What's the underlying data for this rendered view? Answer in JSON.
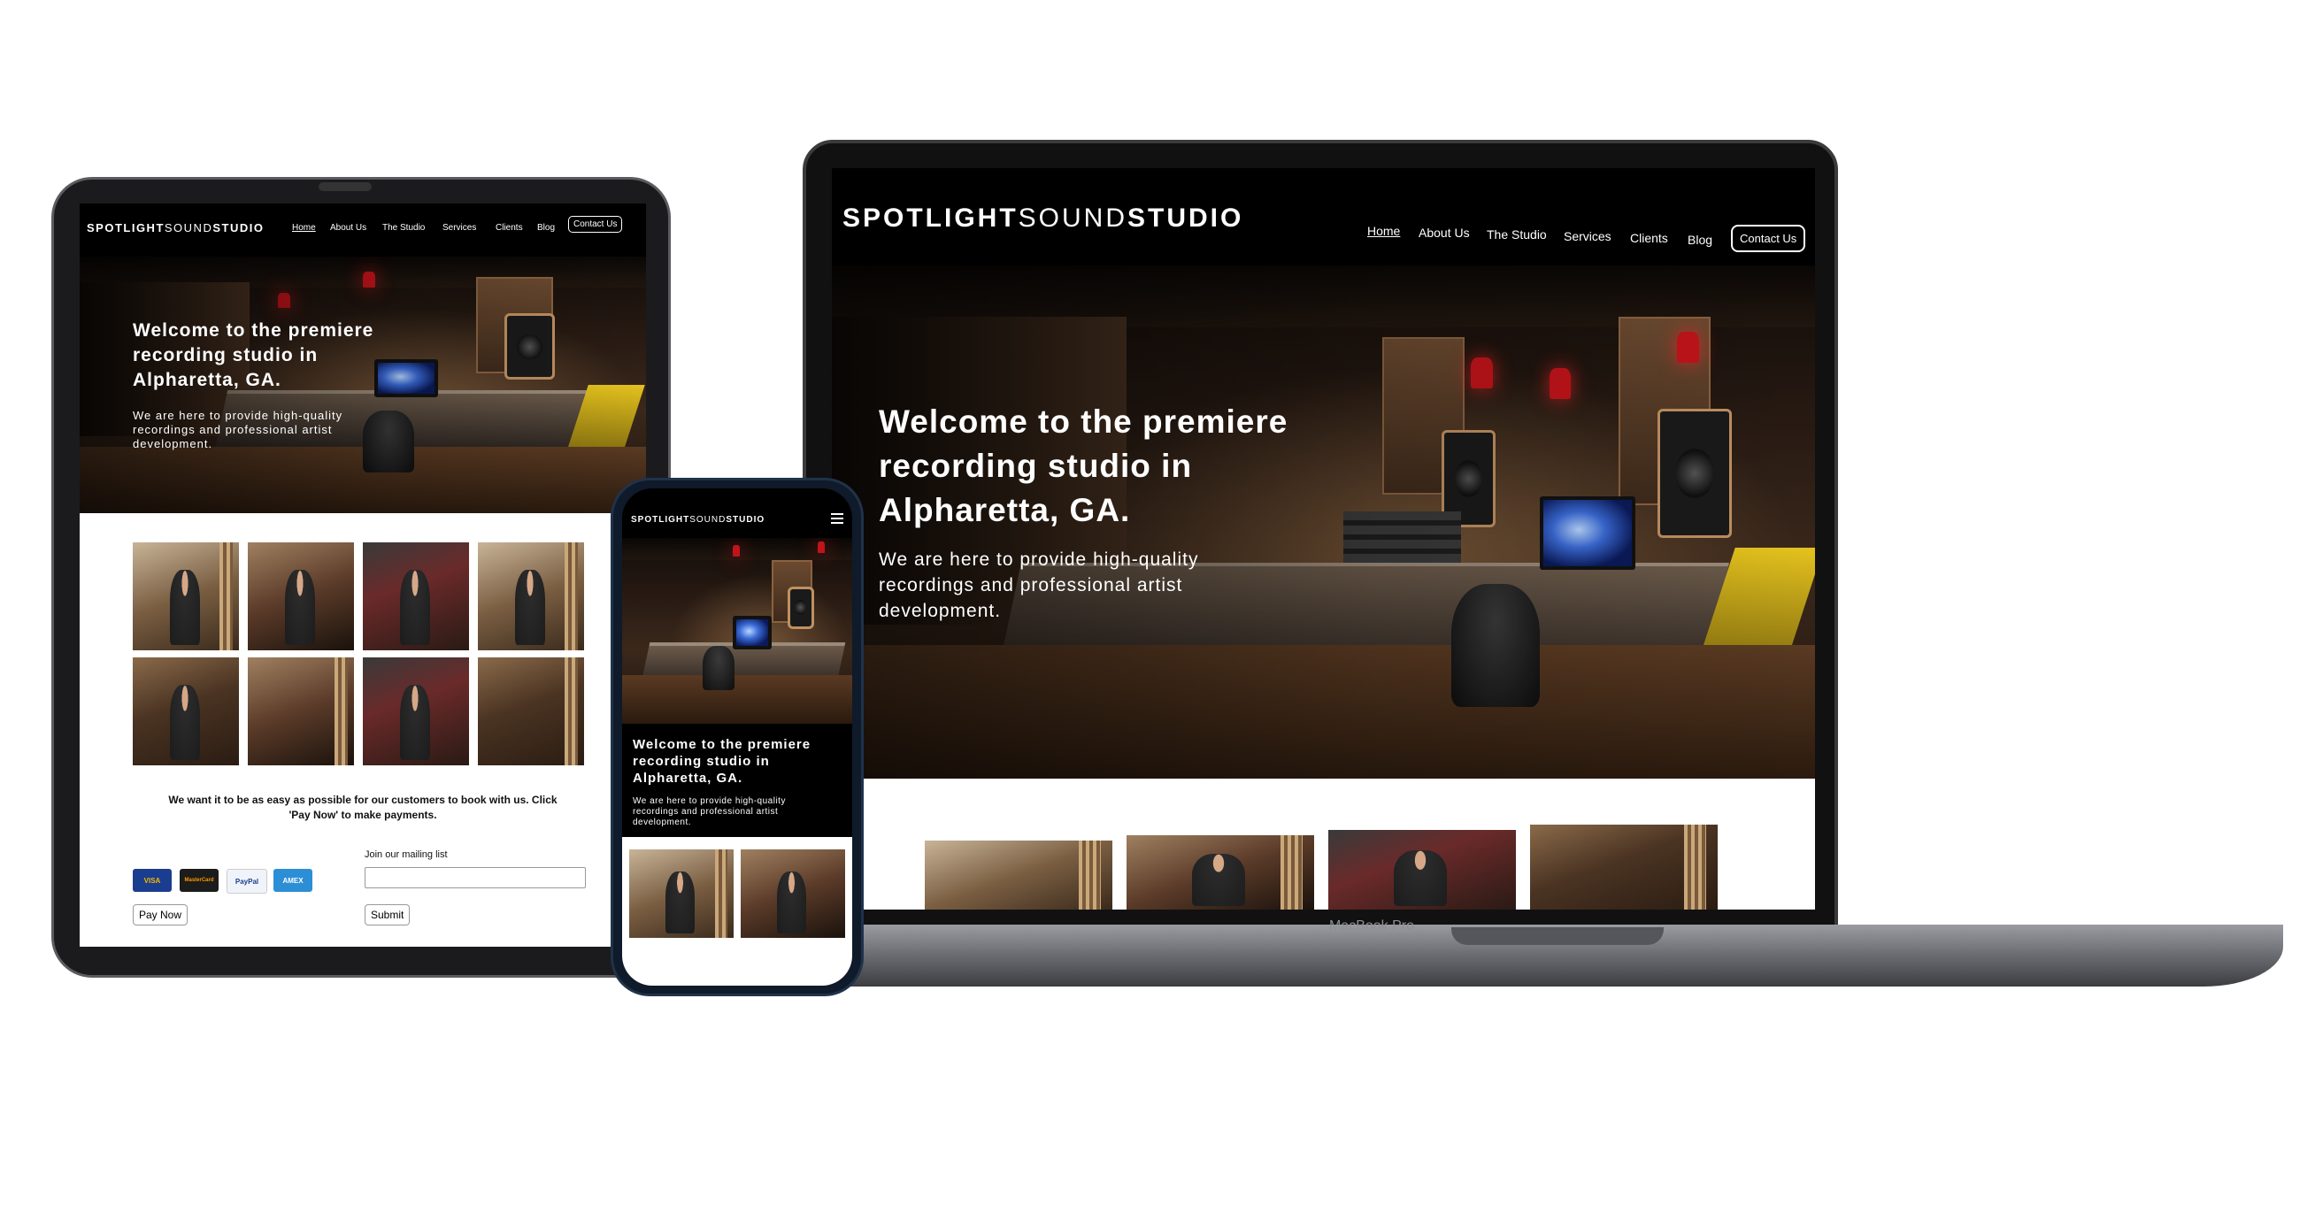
{
  "brand": {
    "word1": "SPOTLIGHT",
    "word2": "SOUND",
    "word3": "STUDIO"
  },
  "nav": {
    "items": [
      "Home",
      "About Us",
      "The Studio",
      "Services",
      "Clients",
      "Blog"
    ],
    "contact": "Contact Us"
  },
  "hero": {
    "heading_line1": "Welcome to the premiere",
    "heading_line2": "recording studio in",
    "heading_line3": "Alpharetta, GA.",
    "body_line1": "We are here to provide high-quality",
    "body_line2": "recordings and professional artist",
    "body_line3": "development."
  },
  "tablet": {
    "booking_line1": "We want it to be as easy as possible for our customers to book with us. Click",
    "booking_line2": "'Pay Now' to make payments.",
    "mailing_label": "Join our mailing list",
    "pay_button": "Pay Now",
    "submit_button": "Submit",
    "cards": [
      "VISA",
      "MasterCard",
      "PayPal",
      "AMEX"
    ]
  },
  "phone": {
    "hero_line1": "Welcome to the premiere",
    "hero_line2": "recording studio in",
    "hero_line3": "Alpharetta, GA.",
    "body_line1": "We are here to provide high-quality",
    "body_line2": "recordings and professional artist",
    "body_line3": "development."
  },
  "laptop": {
    "model_label": "MacBook Pro"
  },
  "colors": {
    "accent_red": "#c0141a",
    "synth_yellow": "#e4c21e"
  }
}
